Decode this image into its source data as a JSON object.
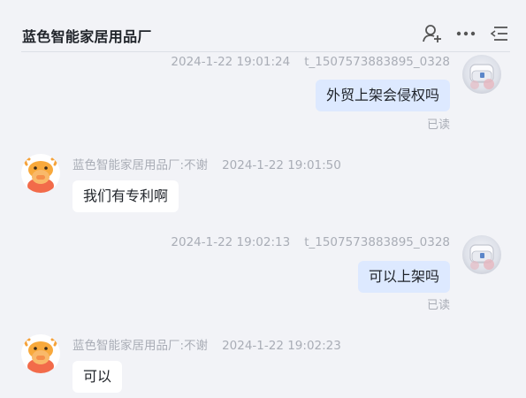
{
  "header": {
    "title": "蓝色智能家居用品厂",
    "icons": [
      "add-user-icon",
      "more-icon",
      "menu-collapse-icon"
    ]
  },
  "messages": [
    {
      "direction": "out",
      "timestamp": "2024-1-22 19:01:24",
      "sender": "t_1507573883895_0328",
      "text": "外贸上架会侵权吗",
      "status": "已读"
    },
    {
      "direction": "in",
      "sender": "蓝色智能家居用品厂:不谢",
      "timestamp": "2024-1-22 19:01:50",
      "text": "我们有专利啊"
    },
    {
      "direction": "out",
      "timestamp": "2024-1-22 19:02:13",
      "sender": "t_1507573883895_0328",
      "text": "可以上架吗",
      "status": "已读"
    },
    {
      "direction": "in",
      "sender": "蓝色智能家居用品厂:不谢",
      "timestamp": "2024-1-22 19:02:23",
      "text": "可以"
    }
  ],
  "colors": {
    "background": "#f2f3f7",
    "outgoing_bubble": "#dde9ff",
    "incoming_bubble": "#ffffff",
    "meta_text": "#a9adb6"
  }
}
